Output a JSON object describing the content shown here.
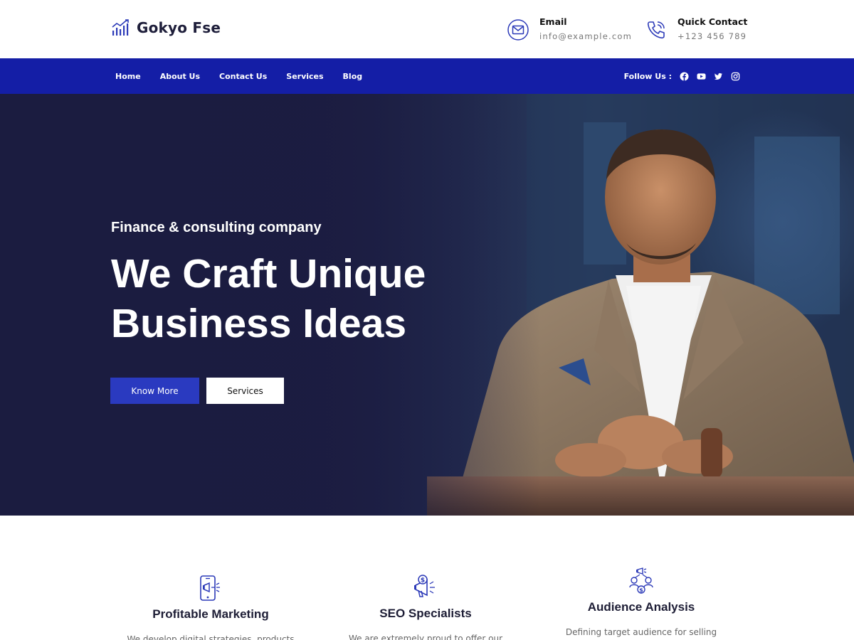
{
  "brand": {
    "name": "Gokyo Fse",
    "icon": "chart-bars-icon"
  },
  "contact": {
    "email": {
      "title": "Email",
      "value": "info@example.com",
      "icon": "envelope-icon"
    },
    "phone": {
      "title": "Quick Contact",
      "value": "+123 456 789",
      "icon": "phone-icon"
    }
  },
  "nav": {
    "items": [
      {
        "label": "Home"
      },
      {
        "label": "About Us"
      },
      {
        "label": "Contact Us"
      },
      {
        "label": "Services"
      },
      {
        "label": "Blog"
      }
    ],
    "follow_label": "Follow Us :",
    "social": [
      "facebook-icon",
      "youtube-icon",
      "twitter-icon",
      "instagram-icon"
    ]
  },
  "hero": {
    "subtitle": "Finance & consulting company",
    "title": "We Craft Unique Business Ideas",
    "primary_button": "Know More",
    "secondary_button": "Services"
  },
  "features": [
    {
      "title": "Profitable Marketing",
      "text": "We develop digital strategies, products",
      "icon": "mobile-megaphone-icon"
    },
    {
      "title": "SEO Specialists",
      "text": "We are extremely proud to offer our",
      "icon": "megaphone-dollar-icon"
    },
    {
      "title": "Audience Analysis",
      "text": "Defining target audience for selling",
      "icon": "audience-network-icon"
    }
  ],
  "colors": {
    "nav_bg": "#141ea6",
    "primary_button": "#2a3ac0",
    "hero_dark": "#1d1f45",
    "icon_blue": "#2c3ab8"
  }
}
